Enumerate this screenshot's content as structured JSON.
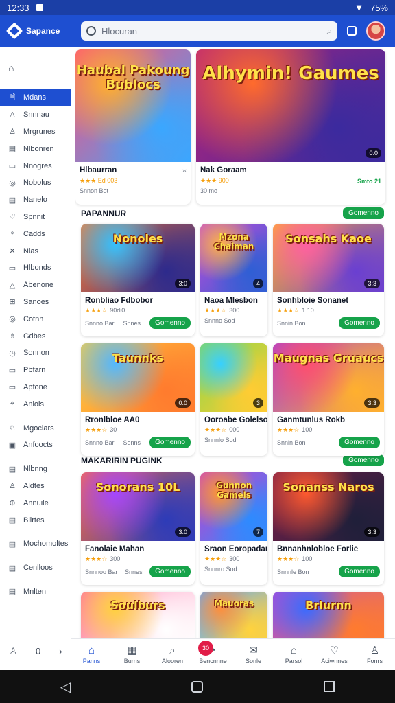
{
  "status_bar": {
    "time": "12:33",
    "battery": "75%"
  },
  "app": {
    "name": "Sapance"
  },
  "search": {
    "value": "Hlocuran"
  },
  "sidebar": {
    "home_icon": "home-icon",
    "items": [
      {
        "label": "Mdans",
        "icon": "🗎",
        "active": true
      },
      {
        "label": "Snnnau",
        "icon": "♙"
      },
      {
        "label": "Mrgrunes",
        "icon": "♙"
      },
      {
        "label": "Nlbonren",
        "icon": "▤"
      },
      {
        "label": "Nnogres",
        "icon": "▭"
      },
      {
        "label": "Nobolus",
        "icon": "◎"
      },
      {
        "label": "Nanelo",
        "icon": "▤"
      },
      {
        "label": "Spnnit",
        "icon": "♡"
      },
      {
        "label": "Cadds",
        "icon": "⌖"
      },
      {
        "label": "Nlas",
        "icon": "✕"
      },
      {
        "label": "Hlbonds",
        "icon": "▭"
      },
      {
        "label": "Abenone",
        "icon": "△"
      },
      {
        "label": "Sanoes",
        "icon": "⊞"
      },
      {
        "label": "Cotnn",
        "icon": "◎"
      },
      {
        "label": "Gdbes",
        "icon": "♗"
      },
      {
        "label": "Sonnon",
        "icon": "◷"
      },
      {
        "label": "Pbfarn",
        "icon": "▭"
      },
      {
        "label": "Apfone",
        "icon": "▭"
      },
      {
        "label": "Anlols",
        "icon": "⌖"
      },
      {
        "gap": true,
        "label": "Mgoclars",
        "icon": "♘"
      },
      {
        "label": "Anfoocts",
        "icon": "▣"
      },
      {
        "gap": true,
        "label": "Nlbnng",
        "icon": "▤"
      },
      {
        "label": "Aldtes",
        "icon": "♙"
      },
      {
        "label": "Annuile",
        "icon": "⊕"
      },
      {
        "label": "Blirtes",
        "icon": "▤"
      },
      {
        "gap": true,
        "label": "Mochomoltes",
        "icon": "▤"
      },
      {
        "gap": true,
        "label": "Cenlloos",
        "icon": "▤"
      },
      {
        "gap": true,
        "label": "Mnlten",
        "icon": "▤"
      }
    ],
    "footer": {
      "count": "0"
    }
  },
  "featured": [
    {
      "title": "Hlbaurran",
      "art": "Haubal Pakoung Bublocs",
      "rating_text": "Ed 003",
      "sub": "Snnon Bot",
      "colors": [
        "#ffb02e",
        "#ff4f7a",
        "#3aa7ff"
      ]
    },
    {
      "title": "Nak Goraam",
      "art": "Alhymin! Gaumes",
      "badge": "0:0",
      "rating_text": "900",
      "sub": "30 mo",
      "tag": "Smto 21",
      "colors": [
        "#ff6b2c",
        "#b8237a",
        "#3b2a9e"
      ]
    }
  ],
  "sections": [
    {
      "title": "PAPANNUR",
      "button": "Gomenno"
    },
    {
      "title": "MAKARIRIN PUGINK",
      "button": "Gomenno"
    }
  ],
  "grid1": [
    {
      "title": "Ronbliao Fdbobor",
      "art": "Nonoles",
      "badge": "3:0",
      "rating_text": "90di0",
      "left": "Snnno Bar",
      "mid": "Snnes",
      "button": "Gomenno",
      "colors": [
        "#34c1ff",
        "#ff7a2e",
        "#2d2a8c"
      ]
    },
    {
      "title": "Naoa Mlesbon",
      "art": "Mzona Chaiman",
      "badge": "4",
      "rating_text": "300",
      "left": "Snnno Sod",
      "colors": [
        "#ffb347",
        "#c44bd7",
        "#2f5fd4"
      ]
    },
    {
      "title": "Sonhbloie Sonanet",
      "art": "Sonsahs Kaoe",
      "badge": "3:3",
      "rating_text": "1.10",
      "left": "Snnin Bon",
      "button": "Gomenno",
      "colors": [
        "#ff5fa2",
        "#ffb02e",
        "#6a3fd1"
      ]
    }
  ],
  "grid2": [
    {
      "title": "Rronlbloe AA0",
      "art": "Taunnks",
      "badge": "0:0",
      "rating_text": "30",
      "left": "Snnno Bar",
      "mid": "Sonns",
      "button": "Gomenno",
      "colors": [
        "#53b8ff",
        "#ffcf40",
        "#ff7b2e"
      ]
    },
    {
      "title": "Ooroabe Golelso",
      "art": "",
      "badge": "3",
      "rating_text": "000",
      "left": "Snnnlo Sod",
      "colors": [
        "#37d0ff",
        "#8bd64a",
        "#ffcc33"
      ]
    },
    {
      "title": "Ganmtunlus Rokb",
      "art": "Maugnas Gruaucs",
      "badge": "3:3",
      "rating_text": "100",
      "left": "Snnin Bon",
      "button": "Gomenno",
      "colors": [
        "#ff4f6d",
        "#a542d6",
        "#ffb02e"
      ]
    }
  ],
  "grid3": [
    {
      "title": "Fanolaie Mahan",
      "art": "Sonorans 10L",
      "badge": "3:0",
      "rating_text": "300",
      "left": "Snnnoo Bar",
      "mid": "Snnes",
      "button": "Gomenno",
      "colors": [
        "#a446ff",
        "#ff6f3c",
        "#2d3bb8"
      ]
    },
    {
      "title": "Sraon Eoropadan",
      "art": "Gunnon Gamels",
      "badge": "7",
      "rating_text": "300",
      "left": "Snnnro Sod",
      "colors": [
        "#ff9a2e",
        "#c940c9",
        "#2d8bff"
      ]
    },
    {
      "title": "Bnnanhnlobloe Forlie",
      "art": "Sonanss Naros",
      "badge": "3:3",
      "rating_text": "100",
      "left": "Snnnle Bon",
      "button": "Gomenno",
      "colors": [
        "#ff5a2e",
        "#7a1f4a",
        "#1f1f3a"
      ]
    }
  ],
  "grid4": [
    {
      "art": "Soulburs",
      "colors": [
        "#ffd23d",
        "#ff6fa8",
        "#ffffff"
      ]
    },
    {
      "art": "Mauoras",
      "colors": [
        "#ff8f3a",
        "#5fa8ff",
        "#ffd23d"
      ]
    },
    {
      "art": "Brlurnn",
      "colors": [
        "#3a6bff",
        "#b44bd7",
        "#ff7b2e"
      ]
    }
  ],
  "bottom_nav": [
    {
      "label": "Panns",
      "icon": "⌂",
      "active": true
    },
    {
      "label": "Burns",
      "icon": "▦"
    },
    {
      "label": "Alooren",
      "icon": "⌕"
    },
    {
      "label": "Bencnnne",
      "icon": "◔",
      "badge": "30"
    },
    {
      "label": "Sonle",
      "icon": "✉"
    },
    {
      "label": "Parsol",
      "icon": "⌂"
    },
    {
      "label": "Aciwnnes",
      "icon": "♡"
    },
    {
      "label": "Fonrs",
      "icon": "♙"
    }
  ]
}
